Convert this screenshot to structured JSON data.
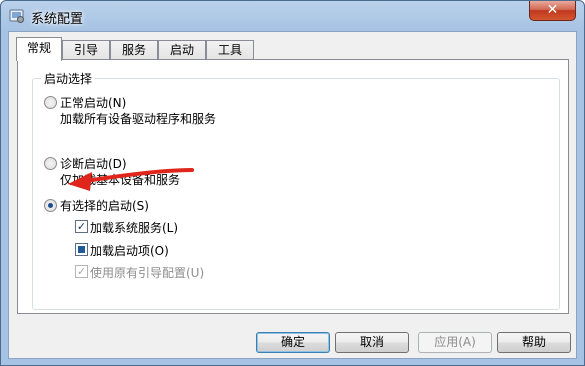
{
  "window": {
    "title": "系统配置",
    "close_label": "✕"
  },
  "tabs": [
    {
      "label": "常规",
      "active": true
    },
    {
      "label": "引导",
      "active": false
    },
    {
      "label": "服务",
      "active": false
    },
    {
      "label": "启动",
      "active": false
    },
    {
      "label": "工具",
      "active": false
    }
  ],
  "startup_selection": {
    "legend": "启动选择",
    "normal": {
      "label": "正常启动(N)",
      "description": "加载所有设备驱动程序和服务",
      "checked": false
    },
    "diagnostic": {
      "label": "诊断启动(D)",
      "description": "仅加载基本设备和服务",
      "checked": false
    },
    "selective": {
      "label": "有选择的启动(S)",
      "checked": true
    },
    "options": [
      {
        "label": "加载系统服务(L)",
        "state": "checked",
        "mark": "✓"
      },
      {
        "label": "加载启动项(O)",
        "state": "indeterminate"
      },
      {
        "label": "使用原有引导配置(U)",
        "state": "checked-disabled",
        "mark": "✓"
      }
    ]
  },
  "buttons": {
    "ok": "确定",
    "cancel": "取消",
    "apply": "应用(A)",
    "help": "帮助"
  },
  "colors": {
    "titlebar": "#b9d1ea",
    "close": "#c0391f",
    "annotation_arrow": "#e0261c"
  }
}
